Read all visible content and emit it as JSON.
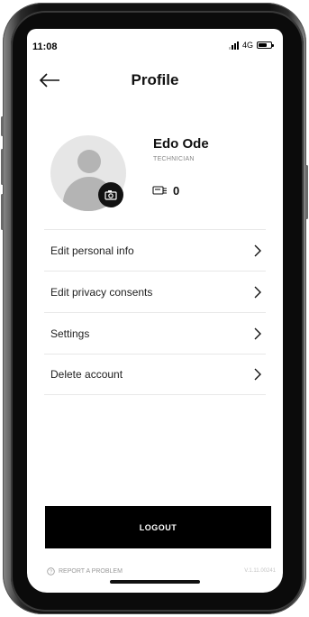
{
  "status_bar": {
    "time": "11:08",
    "network": "4G"
  },
  "header": {
    "title": "Profile",
    "back_icon": "arrow-left-icon"
  },
  "profile": {
    "name": "Edo Ode",
    "role": "TECHNICIAN",
    "points": "0",
    "avatar_icon": "user-placeholder-icon",
    "camera_icon": "camera-icon",
    "points_icon": "points-card-icon"
  },
  "menu": {
    "items": [
      {
        "label": "Edit personal info"
      },
      {
        "label": "Edit privacy consents"
      },
      {
        "label": "Settings"
      },
      {
        "label": "Delete account"
      }
    ]
  },
  "footer": {
    "logout_label": "LOGOUT",
    "report_label": "REPORT A PROBLEM",
    "version": "V.1.11.00241"
  },
  "colors": {
    "primary": "#000000",
    "background": "#ffffff",
    "muted": "#999999",
    "divider": "#e8e8e8"
  }
}
